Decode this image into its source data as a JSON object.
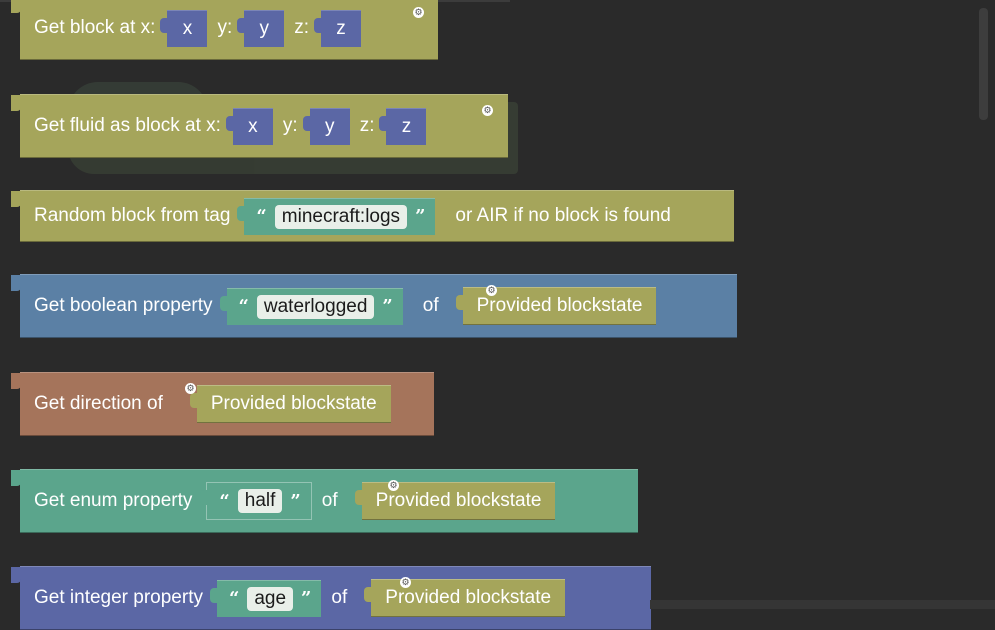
{
  "blocks": {
    "get_block": {
      "label": "Get block at x:",
      "x": "x",
      "y_label": "y:",
      "y": "y",
      "z_label": "z:",
      "z": "z"
    },
    "get_fluid": {
      "label": "Get fluid as block at x:",
      "x": "x",
      "y_label": "y:",
      "y": "y",
      "z_label": "z:",
      "z": "z"
    },
    "random_tag": {
      "label": "Random block from tag",
      "tag": "minecraft:logs",
      "suffix": "or AIR if no block is found"
    },
    "bool_prop": {
      "label": "Get boolean property",
      "prop": "waterlogged",
      "of": "of",
      "state": "Provided blockstate"
    },
    "direction": {
      "label": "Get direction of",
      "state": "Provided blockstate"
    },
    "enum_prop": {
      "label": "Get enum property",
      "prop": "half",
      "of": "of",
      "state": "Provided blockstate"
    },
    "int_prop": {
      "label": "Get integer property",
      "prop": "age",
      "of": "of",
      "state": "Provided blockstate"
    }
  },
  "quote_open": "“",
  "quote_close": "”",
  "icons": {
    "gear": "gear-icon"
  },
  "colors": {
    "olive": "#a5a55b",
    "blue": "#5b80a5",
    "brown": "#a5745b",
    "teal": "#5ba58c",
    "indigo": "#5b67a5",
    "background": "#2a2a2a"
  }
}
